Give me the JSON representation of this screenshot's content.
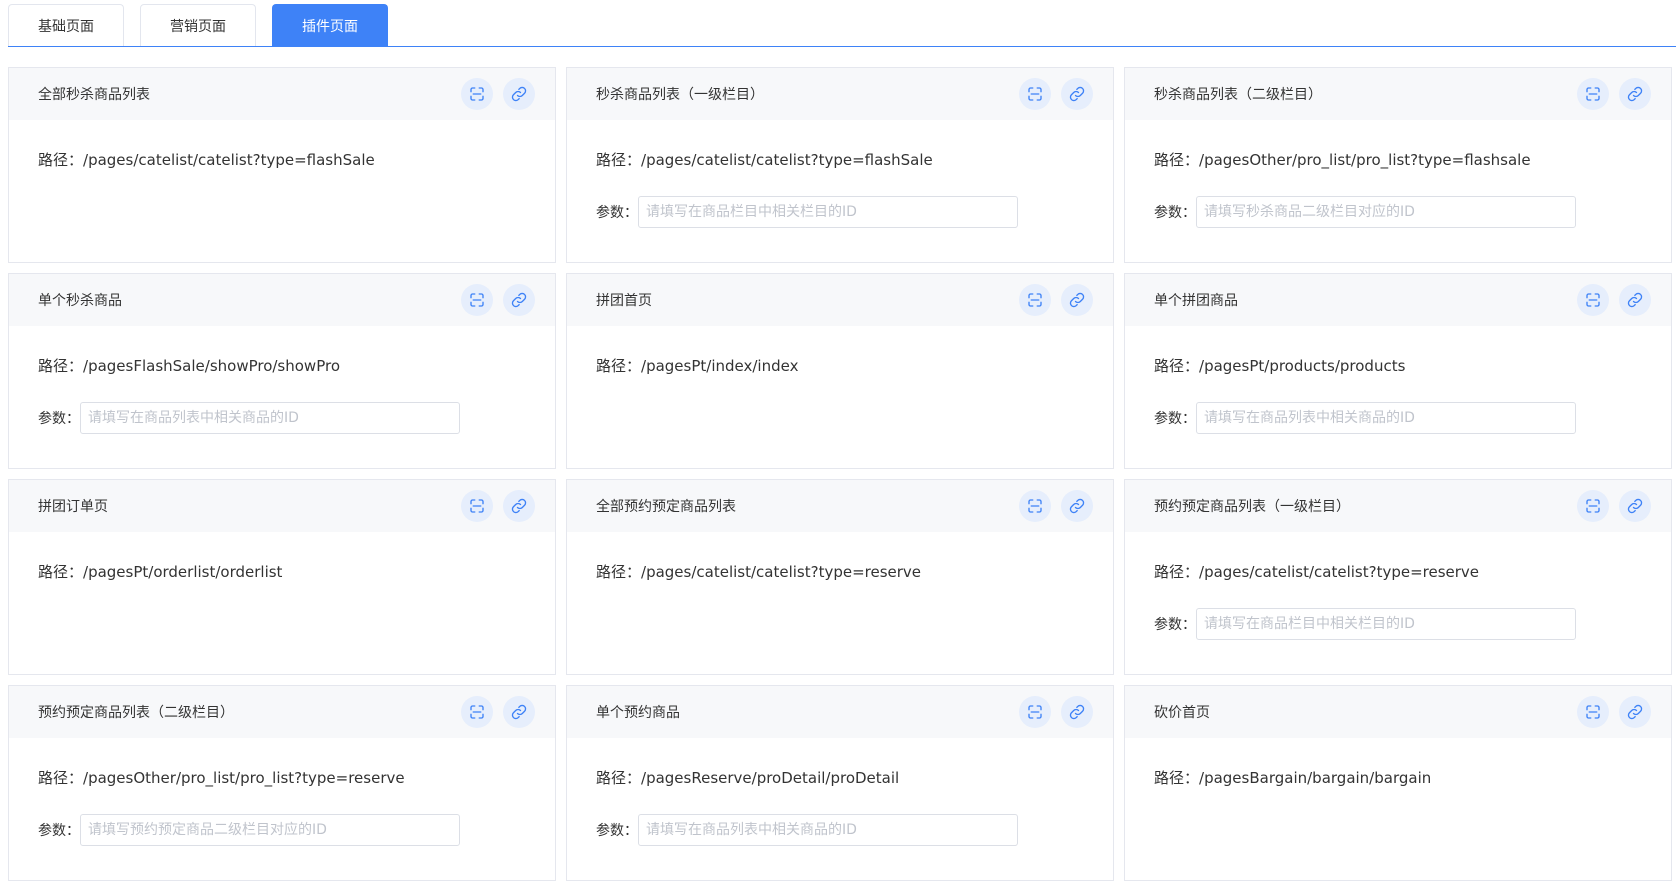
{
  "tabs": [
    {
      "label": "基础页面",
      "active": false
    },
    {
      "label": "营销页面",
      "active": false
    },
    {
      "label": "插件页面",
      "active": true
    }
  ],
  "colors": {
    "accent": "#3e82f7",
    "icon_bg": "#e6eefc",
    "header_bg": "#f7f8fa",
    "border": "#e5e7ee",
    "placeholder": "#c0c4cc"
  },
  "icons": {
    "scan": "scan-icon",
    "link": "link-icon"
  },
  "path_label": "路径：",
  "param_label": "参数：",
  "cards": [
    {
      "title": "全部秒杀商品列表",
      "path": "/pages/catelist/catelist?type=flashSale",
      "placeholder": ""
    },
    {
      "title": "秒杀商品列表（一级栏目）",
      "path": "/pages/catelist/catelist?type=flashSale",
      "placeholder": "请填写在商品栏目中相关栏目的ID"
    },
    {
      "title": "秒杀商品列表（二级栏目）",
      "path": "/pagesOther/pro_list/pro_list?type=flashsale",
      "placeholder": "请填写秒杀商品二级栏目对应的ID"
    },
    {
      "title": "单个秒杀商品",
      "path": "/pagesFlashSale/showPro/showPro",
      "placeholder": "请填写在商品列表中相关商品的ID"
    },
    {
      "title": "拼团首页",
      "path": "/pagesPt/index/index",
      "placeholder": ""
    },
    {
      "title": "单个拼团商品",
      "path": "/pagesPt/products/products",
      "placeholder": "请填写在商品列表中相关商品的ID"
    },
    {
      "title": "拼团订单页",
      "path": "/pagesPt/orderlist/orderlist",
      "placeholder": ""
    },
    {
      "title": "全部预约预定商品列表",
      "path": "/pages/catelist/catelist?type=reserve",
      "placeholder": ""
    },
    {
      "title": "预约预定商品列表（一级栏目）",
      "path": "/pages/catelist/catelist?type=reserve",
      "placeholder": "请填写在商品栏目中相关栏目的ID"
    },
    {
      "title": "预约预定商品列表（二级栏目）",
      "path": "/pagesOther/pro_list/pro_list?type=reserve",
      "placeholder": "请填写预约预定商品二级栏目对应的ID"
    },
    {
      "title": "单个预约商品",
      "path": "/pagesReserve/proDetail/proDetail",
      "placeholder": "请填写在商品列表中相关商品的ID"
    },
    {
      "title": "砍价首页",
      "path": "/pagesBargain/bargain/bargain",
      "placeholder": ""
    }
  ]
}
